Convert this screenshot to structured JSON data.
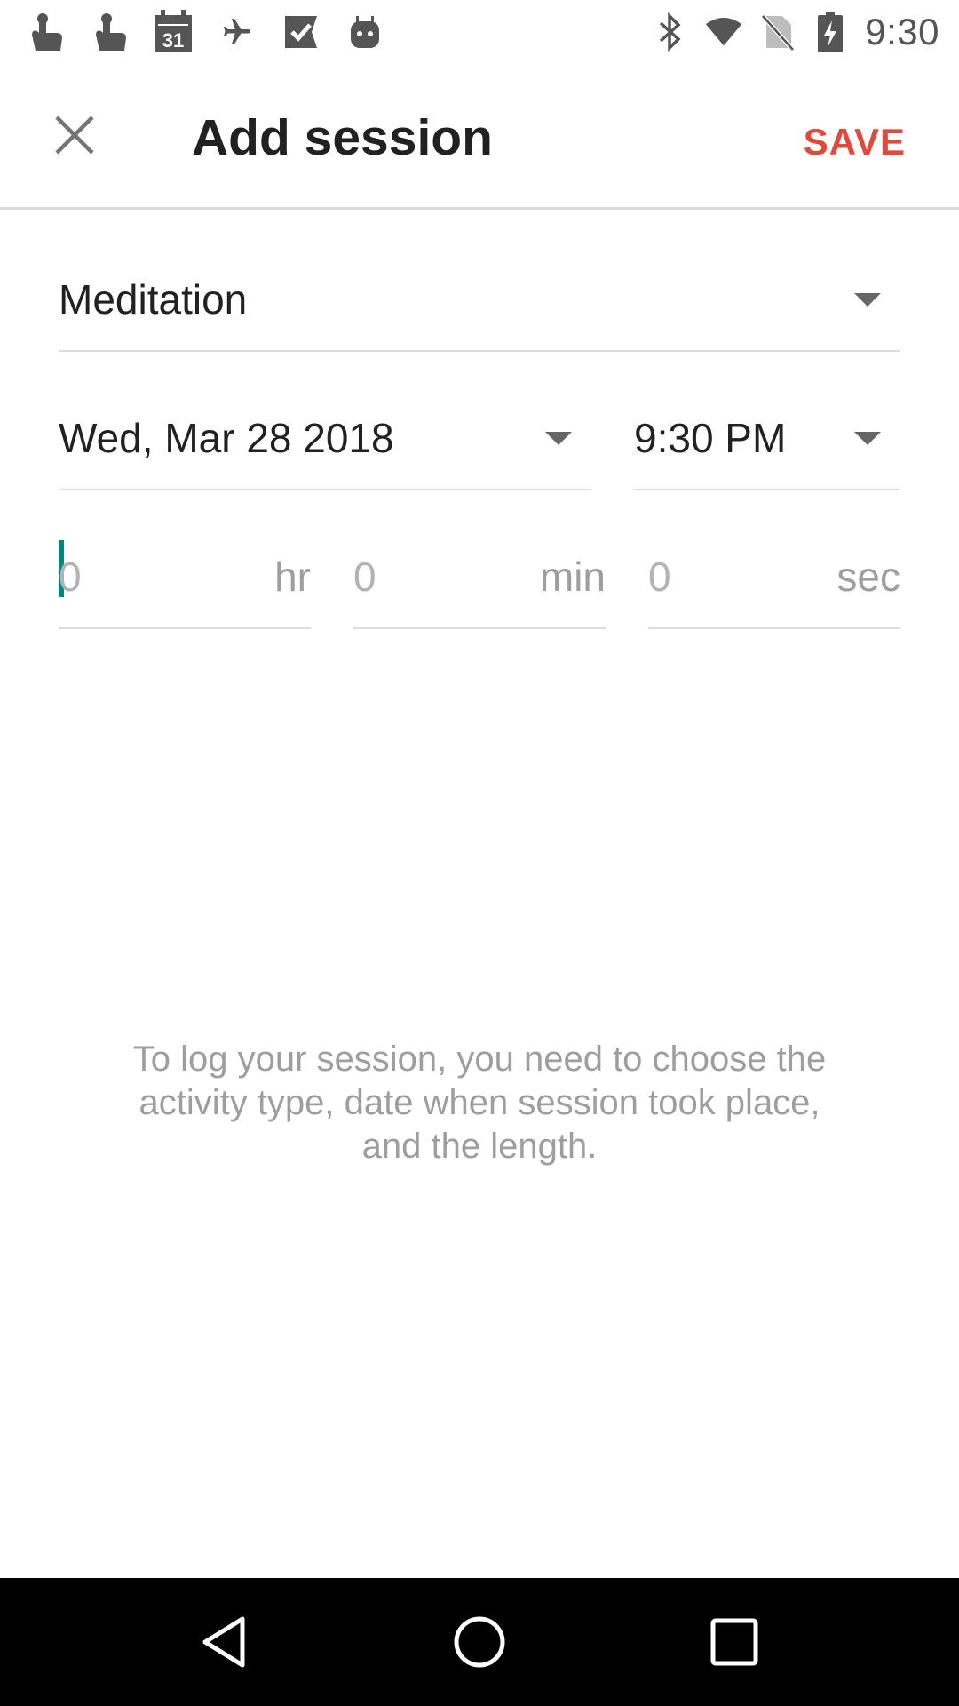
{
  "status_bar": {
    "time": "9:30",
    "calendar_day": "31",
    "left_icons": [
      "touch-app-icon",
      "touch-app-icon",
      "calendar-icon",
      "airplane-icon",
      "check-flag-icon",
      "android-icon"
    ],
    "right_icons": [
      "bluetooth-icon",
      "wifi-icon",
      "no-sim-icon",
      "battery-charging-icon"
    ]
  },
  "toolbar": {
    "title": "Add session",
    "save_label": "SAVE",
    "close_icon": "close-icon"
  },
  "form": {
    "activity": "Meditation",
    "date": "Wed, Mar 28 2018",
    "time": "9:30 PM",
    "duration": {
      "hours_placeholder": "0",
      "hours_unit": "hr",
      "minutes_placeholder": "0",
      "minutes_unit": "min",
      "seconds_placeholder": "0",
      "seconds_unit": "sec"
    }
  },
  "help_text": "To log your session, you need to choose the activity type, date when session took place, and the length.",
  "colors": {
    "accent": "#e0493c",
    "cursor": "#00897b"
  },
  "nav_bar": {
    "icons": [
      "back-icon",
      "home-icon",
      "recents-icon"
    ]
  }
}
